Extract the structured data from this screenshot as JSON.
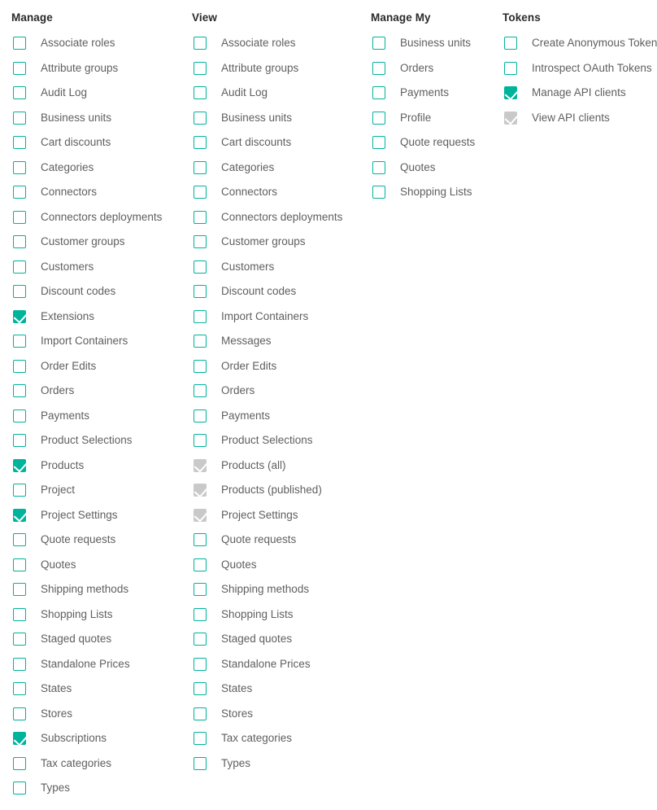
{
  "theme": {
    "accent_color": "#00b39b",
    "disabled_color": "#c9c9c9",
    "label_color": "#5f5f5f",
    "title_color": "#2b2b2b",
    "background_color": "#ffffff"
  },
  "columns": [
    {
      "title": "Manage",
      "options": [
        {
          "label": "Associate roles",
          "checked": false,
          "disabled": false
        },
        {
          "label": "Attribute groups",
          "checked": false,
          "disabled": false
        },
        {
          "label": "Audit Log",
          "checked": false,
          "disabled": false
        },
        {
          "label": "Business units",
          "checked": false,
          "disabled": false
        },
        {
          "label": "Cart discounts",
          "checked": false,
          "disabled": false
        },
        {
          "label": "Categories",
          "checked": false,
          "disabled": false
        },
        {
          "label": "Connectors",
          "checked": false,
          "disabled": false
        },
        {
          "label": "Connectors deployments",
          "checked": false,
          "disabled": false
        },
        {
          "label": "Customer groups",
          "checked": false,
          "disabled": false
        },
        {
          "label": "Customers",
          "checked": false,
          "disabled": false
        },
        {
          "label": "Discount codes",
          "checked": false,
          "disabled": false
        },
        {
          "label": "Extensions",
          "checked": true,
          "disabled": false
        },
        {
          "label": "Import Containers",
          "checked": false,
          "disabled": false
        },
        {
          "label": "Order Edits",
          "checked": false,
          "disabled": false
        },
        {
          "label": "Orders",
          "checked": false,
          "disabled": false
        },
        {
          "label": "Payments",
          "checked": false,
          "disabled": false
        },
        {
          "label": "Product Selections",
          "checked": false,
          "disabled": false
        },
        {
          "label": "Products",
          "checked": true,
          "disabled": false
        },
        {
          "label": "Project",
          "checked": false,
          "disabled": false
        },
        {
          "label": "Project Settings",
          "checked": true,
          "disabled": false
        },
        {
          "label": "Quote requests",
          "checked": false,
          "disabled": false
        },
        {
          "label": "Quotes",
          "checked": false,
          "disabled": false
        },
        {
          "label": "Shipping methods",
          "checked": false,
          "disabled": false
        },
        {
          "label": "Shopping Lists",
          "checked": false,
          "disabled": false
        },
        {
          "label": "Staged quotes",
          "checked": false,
          "disabled": false
        },
        {
          "label": "Standalone Prices",
          "checked": false,
          "disabled": false
        },
        {
          "label": "States",
          "checked": false,
          "disabled": false
        },
        {
          "label": "Stores",
          "checked": false,
          "disabled": false
        },
        {
          "label": "Subscriptions",
          "checked": true,
          "disabled": false
        },
        {
          "label": "Tax categories",
          "checked": false,
          "disabled": false
        },
        {
          "label": "Types",
          "checked": false,
          "disabled": false
        }
      ]
    },
    {
      "title": "View",
      "options": [
        {
          "label": "Associate roles",
          "checked": false,
          "disabled": false
        },
        {
          "label": "Attribute groups",
          "checked": false,
          "disabled": false
        },
        {
          "label": "Audit Log",
          "checked": false,
          "disabled": false
        },
        {
          "label": "Business units",
          "checked": false,
          "disabled": false
        },
        {
          "label": "Cart discounts",
          "checked": false,
          "disabled": false
        },
        {
          "label": "Categories",
          "checked": false,
          "disabled": false
        },
        {
          "label": "Connectors",
          "checked": false,
          "disabled": false
        },
        {
          "label": "Connectors deployments",
          "checked": false,
          "disabled": false
        },
        {
          "label": "Customer groups",
          "checked": false,
          "disabled": false
        },
        {
          "label": "Customers",
          "checked": false,
          "disabled": false
        },
        {
          "label": "Discount codes",
          "checked": false,
          "disabled": false
        },
        {
          "label": "Import Containers",
          "checked": false,
          "disabled": false
        },
        {
          "label": "Messages",
          "checked": false,
          "disabled": false
        },
        {
          "label": "Order Edits",
          "checked": false,
          "disabled": false
        },
        {
          "label": "Orders",
          "checked": false,
          "disabled": false
        },
        {
          "label": "Payments",
          "checked": false,
          "disabled": false
        },
        {
          "label": "Product Selections",
          "checked": false,
          "disabled": false
        },
        {
          "label": "Products (all)",
          "checked": true,
          "disabled": true
        },
        {
          "label": "Products (published)",
          "checked": true,
          "disabled": true
        },
        {
          "label": "Project Settings",
          "checked": true,
          "disabled": true
        },
        {
          "label": "Quote requests",
          "checked": false,
          "disabled": false
        },
        {
          "label": "Quotes",
          "checked": false,
          "disabled": false
        },
        {
          "label": "Shipping methods",
          "checked": false,
          "disabled": false
        },
        {
          "label": "Shopping Lists",
          "checked": false,
          "disabled": false
        },
        {
          "label": "Staged quotes",
          "checked": false,
          "disabled": false
        },
        {
          "label": "Standalone Prices",
          "checked": false,
          "disabled": false
        },
        {
          "label": "States",
          "checked": false,
          "disabled": false
        },
        {
          "label": "Stores",
          "checked": false,
          "disabled": false
        },
        {
          "label": "Tax categories",
          "checked": false,
          "disabled": false
        },
        {
          "label": "Types",
          "checked": false,
          "disabled": false
        }
      ]
    },
    {
      "title": "Manage My",
      "options": [
        {
          "label": "Business units",
          "checked": false,
          "disabled": false
        },
        {
          "label": "Orders",
          "checked": false,
          "disabled": false
        },
        {
          "label": "Payments",
          "checked": false,
          "disabled": false
        },
        {
          "label": "Profile",
          "checked": false,
          "disabled": false
        },
        {
          "label": "Quote requests",
          "checked": false,
          "disabled": false
        },
        {
          "label": "Quotes",
          "checked": false,
          "disabled": false
        },
        {
          "label": "Shopping Lists",
          "checked": false,
          "disabled": false
        }
      ]
    },
    {
      "title": "Tokens",
      "options": [
        {
          "label": "Create Anonymous Token",
          "checked": false,
          "disabled": false
        },
        {
          "label": "Introspect OAuth Tokens",
          "checked": false,
          "disabled": false
        },
        {
          "label": "Manage API clients",
          "checked": true,
          "disabled": false
        },
        {
          "label": "View API clients",
          "checked": true,
          "disabled": true
        }
      ]
    }
  ]
}
